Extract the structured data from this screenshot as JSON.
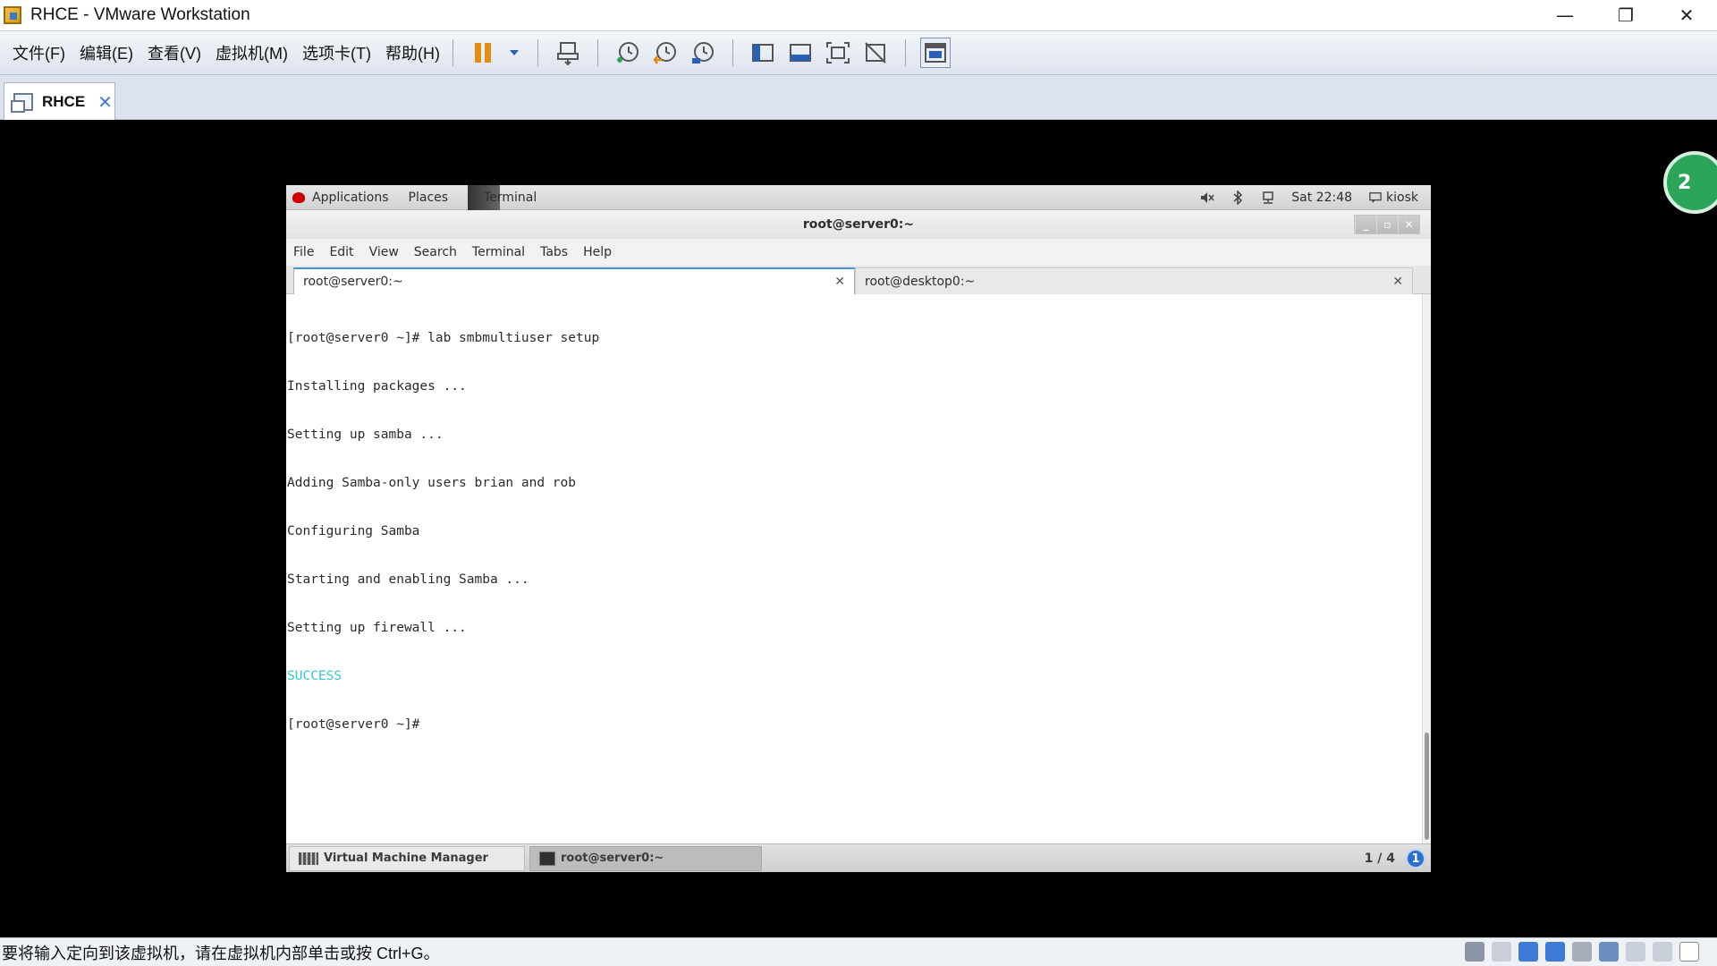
{
  "host": {
    "title": "RHCE - VMware Workstation",
    "controls": {
      "minimize": "—",
      "restore": "❐",
      "close": "✕"
    },
    "menu": [
      "文件(F)",
      "编辑(E)",
      "查看(V)",
      "虚拟机(M)",
      "选项卡(T)",
      "帮助(H)"
    ],
    "tab": {
      "label": "RHCE",
      "close": "✕"
    },
    "badge": "2",
    "status_text": "要将输入定向到该虚拟机，请在虚拟机内部单击或按 Ctrl+G。",
    "colors": {
      "accent": "#e38b13",
      "tab_close": "#4a7bd0"
    }
  },
  "guest": {
    "topbar": {
      "applications": "Applications",
      "places": "Places",
      "terminal": "Terminal",
      "clock": "Sat 22:48",
      "user": "kiosk"
    },
    "terminal": {
      "title": "root@server0:~",
      "menu": [
        "File",
        "Edit",
        "View",
        "Search",
        "Terminal",
        "Tabs",
        "Help"
      ],
      "tabs": [
        {
          "label": "root@server0:~",
          "close": "✕"
        },
        {
          "label": "root@desktop0:~",
          "close": "✕"
        }
      ],
      "lines": [
        "[root@server0 ~]# lab smbmultiuser setup",
        "Installing packages ...",
        "Setting up samba ...",
        "Adding Samba-only users brian and rob",
        "Configuring Samba",
        "Starting and enabling Samba ...",
        "Setting up firewall ...",
        "SUCCESS",
        "[root@server0 ~]#"
      ],
      "success_color": "#34c8d0"
    },
    "bottombar": {
      "tasks": [
        "Virtual Machine Manager",
        "root@server0:~"
      ],
      "workspace": "1 / 4",
      "notify": "1"
    }
  }
}
